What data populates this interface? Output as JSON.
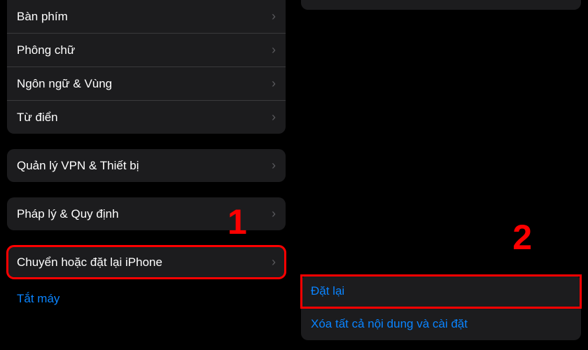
{
  "left": {
    "general_rows": [
      {
        "label": "Bàn phím"
      },
      {
        "label": "Phông chữ"
      },
      {
        "label": "Ngôn ngữ & Vùng"
      },
      {
        "label": "Từ điển"
      }
    ],
    "vpn_label": "Quản lý VPN & Thiết bị",
    "legal_label": "Pháp lý & Quy định",
    "transfer_reset_label": "Chuyển hoặc đặt lại iPhone",
    "shutdown_label": "Tắt máy"
  },
  "right": {
    "reset_label": "Đặt lại",
    "erase_label": "Xóa tất cả nội dung và cài đặt"
  },
  "annotations": {
    "step1": "1",
    "step2": "2"
  },
  "chevron": "›"
}
